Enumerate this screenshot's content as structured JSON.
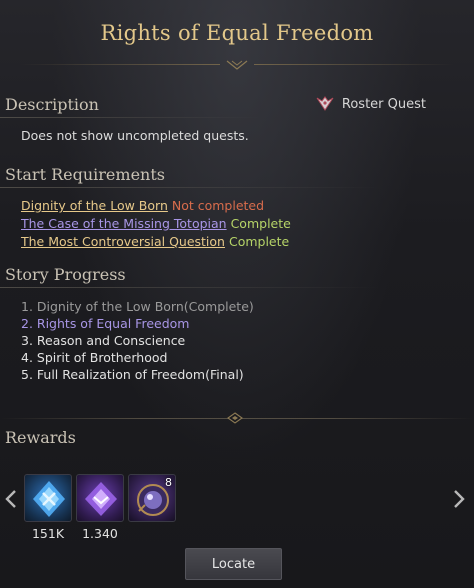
{
  "dialog": {
    "title": "Rights of Equal Freedom"
  },
  "description": {
    "heading": "Description",
    "quest_type": "Roster Quest",
    "text": "Does not show uncompleted quests."
  },
  "start_requirements": {
    "heading": "Start Requirements",
    "items": [
      {
        "name": "Dignity of the Low Born",
        "status": "Not completed"
      },
      {
        "name": "The Case of the Missing Totopian",
        "status": "Complete"
      },
      {
        "name": "The Most Controversial Question",
        "status": "Complete"
      }
    ]
  },
  "story_progress": {
    "heading": "Story Progress",
    "steps": [
      "1. Dignity of the Low Born(Complete)",
      "2. Rights of Equal Freedom",
      "3. Reason and Conscience",
      "4. Spirit of Brotherhood",
      "5. Full Realization of Freedom(Final)"
    ]
  },
  "rewards": {
    "heading": "Rewards",
    "items": [
      {
        "icon": "blue-crystal-icon",
        "label": "151K",
        "count": ""
      },
      {
        "icon": "purple-crystal-icon",
        "label": "1.340",
        "count": ""
      },
      {
        "icon": "card-pack-icon",
        "label": "",
        "count": "8"
      }
    ]
  },
  "actions": {
    "locate_label": "Locate"
  },
  "colors": {
    "title": "#e3c88a",
    "not_completed": "#d86c4c",
    "complete": "#b6d468",
    "current_step": "#a896e6"
  }
}
